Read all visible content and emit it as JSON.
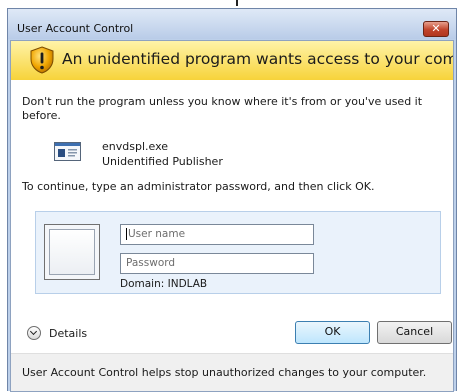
{
  "window": {
    "title": "User Account Control",
    "close_symbol": "✕"
  },
  "banner": {
    "text": "An unidentified program wants access to your computer",
    "icon": "shield-icon"
  },
  "body": {
    "warning": "Don't run the program unless you know where it's from or you've used it before.",
    "program_name": "envdspl.exe",
    "publisher": "Unidentified Publisher",
    "instruction": "To continue, type an administrator password, and then click OK."
  },
  "credentials": {
    "username_placeholder": "User name",
    "password_placeholder": "Password",
    "domain": "Domain: INDLAB"
  },
  "actions": {
    "details_label": "Details",
    "ok_label": "OK",
    "cancel_label": "Cancel"
  },
  "footer": {
    "text": "User Account Control helps stop unauthorized changes to your computer."
  },
  "colors": {
    "banner_top": "#fff3a8",
    "banner_bottom": "#f7d33a",
    "frame": "#bdd0ea",
    "close": "#c1432b"
  }
}
